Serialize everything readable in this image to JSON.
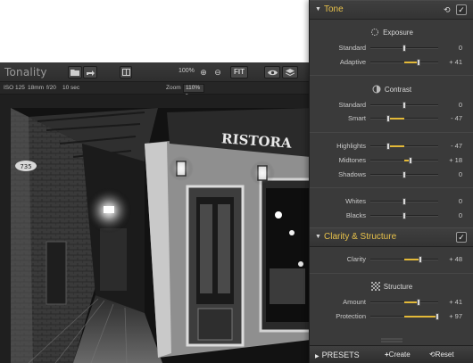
{
  "app": {
    "title": "Tonality"
  },
  "toolbar": {
    "zoom_percent": "100%",
    "fit_label": "FIT"
  },
  "info": {
    "iso": "ISO 125",
    "focal": "18mm",
    "aperture": "f/20",
    "shutter": "10 sec",
    "zoom_label": "Zoom",
    "zoom_value": "110%"
  },
  "panel": {
    "tone": {
      "title": "Tone",
      "exposure": {
        "title": "Exposure",
        "rows": [
          {
            "label": "Standard",
            "value": "0",
            "level": 0
          },
          {
            "label": "Adaptive",
            "value": "+ 41",
            "level": 41
          }
        ]
      },
      "contrast": {
        "title": "Contrast",
        "rows": [
          {
            "label": "Standard",
            "value": "0",
            "level": 0
          },
          {
            "label": "Smart",
            "value": "- 47",
            "level": -47
          }
        ]
      },
      "tonal_rows": [
        {
          "label": "Highlights",
          "value": "- 47",
          "level": -47
        },
        {
          "label": "Midtones",
          "value": "+ 18",
          "level": 18
        },
        {
          "label": "Shadows",
          "value": "0",
          "level": 0
        }
      ],
      "wb_rows": [
        {
          "label": "Whites",
          "value": "0",
          "level": 0
        },
        {
          "label": "Blacks",
          "value": "0",
          "level": 0
        }
      ]
    },
    "clarity": {
      "title": "Clarity & Structure",
      "clarity_row": {
        "label": "Clarity",
        "value": "+ 48",
        "level": 48
      },
      "structure": {
        "title": "Structure",
        "rows": [
          {
            "label": "Amount",
            "value": "+ 41",
            "level": 41
          },
          {
            "label": "Protection",
            "value": "+ 97",
            "level": 97
          }
        ]
      }
    },
    "bottom": {
      "presets": "PRESETS",
      "create": "Create",
      "reset": "Reset"
    }
  },
  "photo": {
    "sign_text": "RISTORA",
    "house_number": "735"
  },
  "colors": {
    "accent": "#e3b938",
    "panel_bg": "#3a3a3a",
    "window_bg": "#2b2b2b"
  }
}
